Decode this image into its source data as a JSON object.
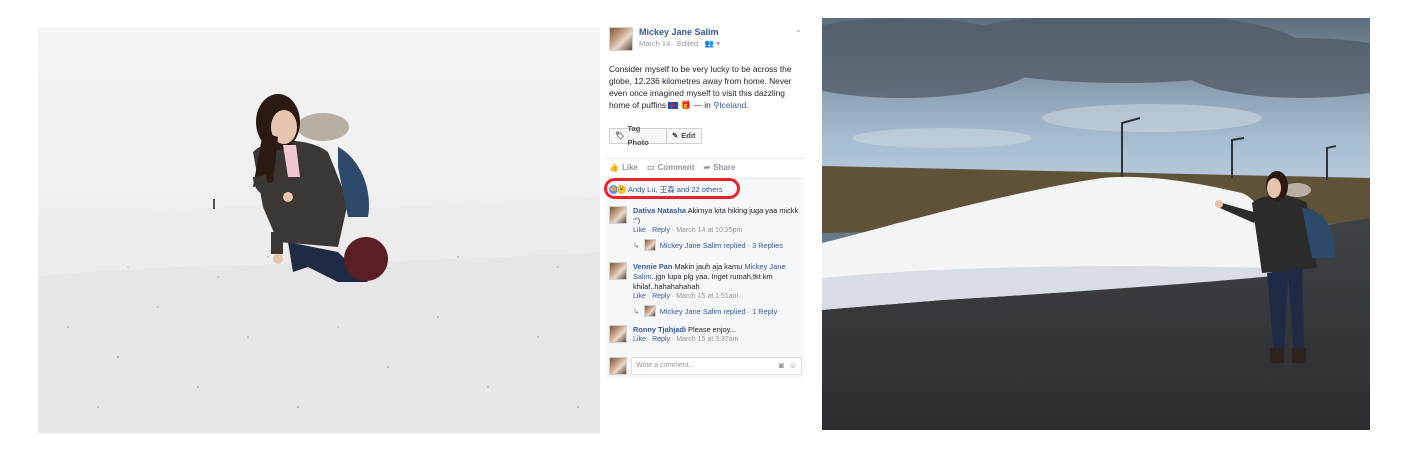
{
  "post": {
    "author": "Mickey Jane Salim",
    "meta": "March 14 · Edited · 👥 ▾",
    "text_main": "Consider myself to be very lucky to be across the globe, 12.236 kilometres away from home. Never even once imagined myself to visit this dazzling home of puffins",
    "text_tail": "— in",
    "location": "Iceland.",
    "tag_photo_label": "Tag Photo",
    "edit_label": "Edit"
  },
  "actions": {
    "like": "Like",
    "comment": "Comment",
    "share": "Share"
  },
  "reactions": {
    "text": "Andy Lu, 王森 and 22 others"
  },
  "comments": [
    {
      "name": "Dativa Natasha",
      "text": "Akirnya kita hiking juga yaa mickk :\")",
      "like": "Like",
      "reply": "Reply",
      "time": "March 14 at 10:25pm",
      "replied": "Mickey Jane Salim replied · 3 Replies"
    },
    {
      "name": "Vennie Pan",
      "text_pre": "Makin jauh aja kamu",
      "mention": "Mickey Jane Salim",
      "text_post": "..jgn lupa plg yaa. Inget rumah,tkt km khilaf..hahahahahah",
      "like": "Like",
      "reply": "Reply",
      "time": "March 15 at 1:51am",
      "replied": "Mickey Jane Salim replied · 1 Reply"
    },
    {
      "name": "Ronny Tjahjadi",
      "text": "Please enjoy...",
      "like": "Like",
      "reply": "Reply",
      "time": "March 15 at 3:37am"
    }
  ],
  "write_comment": {
    "placeholder": "Write a comment..."
  },
  "colors": {
    "fb_link": "#365899",
    "highlight": "#e8242a",
    "muted": "#90949c"
  },
  "icons": [
    "tag-icon",
    "pencil-icon",
    "like-icon",
    "comment-icon",
    "share-icon",
    "camera-icon",
    "emoji-icon",
    "location-pin-icon",
    "chevron-down-icon"
  ]
}
